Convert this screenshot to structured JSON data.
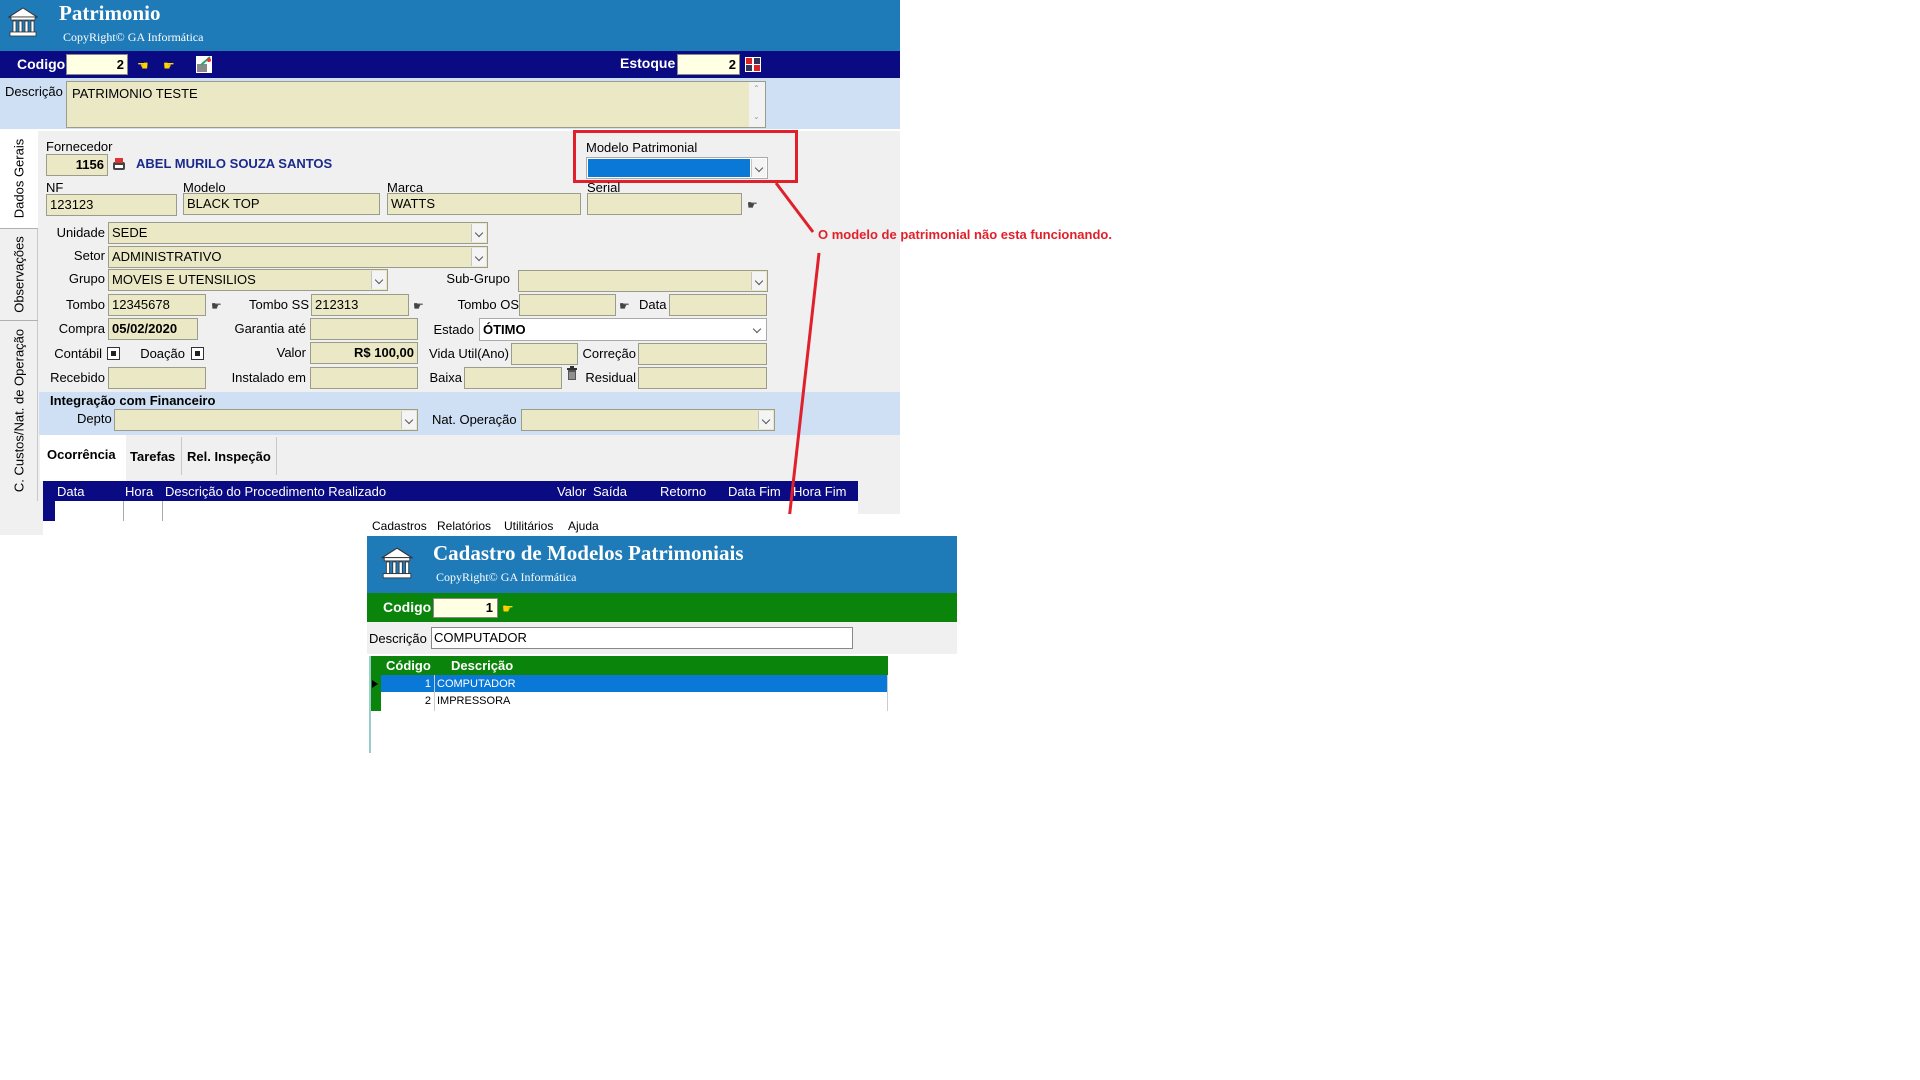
{
  "patrimonio": {
    "title": "Patrimonio",
    "copyright": "CopyRight© GA Informática",
    "codigo_label": "Codigo",
    "codigo_value": "2",
    "estoque_label": "Estoque",
    "estoque_value": "2",
    "descricao_label": "Descrição",
    "descricao_value": "PATRIMONIO TESTE",
    "side_tabs": [
      "Dados Gerais",
      "Observações",
      "C. Custos/Nat. de Operação"
    ],
    "fornecedor_label": "Fornecedor",
    "fornecedor_code": "1156",
    "fornecedor_name": "ABEL MURILO SOUZA SANTOS",
    "modelo_patrimonial_label": "Modelo Patrimonial",
    "modelo_patrimonial_value": "",
    "nf_label": "NF",
    "nf_value": "123123",
    "modelo_label": "Modelo",
    "modelo_value": "BLACK TOP",
    "marca_label": "Marca",
    "marca_value": "WATTS",
    "serial_label": "Serial",
    "serial_value": "",
    "unidade_label": "Unidade",
    "unidade_value": "SEDE",
    "setor_label": "Setor",
    "setor_value": "ADMINISTRATIVO",
    "grupo_label": "Grupo",
    "grupo_value": "MOVEIS E UTENSILIOS",
    "subgrupo_label": "Sub-Grupo",
    "subgrupo_value": "",
    "tombo_label": "Tombo",
    "tombo_value": "12345678",
    "tombo_ss_label": "Tombo SS",
    "tombo_ss_value": "212313",
    "tombo_os_label": "Tombo OS",
    "tombo_os_value": "",
    "data_label": "Data",
    "data_value": "",
    "compra_label": "Compra",
    "compra_value": "05/02/2020",
    "garantia_label": "Garantia até",
    "garantia_value": "",
    "estado_label": "Estado",
    "estado_value": "ÓTIMO",
    "contabil_label": "Contábil",
    "doacao_label": "Doação",
    "valor_label": "Valor",
    "valor_value": "R$ 100,00",
    "vida_util_label": "Vida Util(Ano)",
    "vida_util_value": "",
    "correcao_label": "Correção",
    "correcao_value": "",
    "recebido_label": "Recebido",
    "recebido_value": "",
    "instalado_label": "Instalado em",
    "instalado_value": "",
    "baixa_label": "Baixa",
    "baixa_value": "",
    "residual_label": "Residual",
    "residual_value": "",
    "integracao_label": "Integração com Financeiro",
    "depto_label": "Depto",
    "depto_value": "",
    "nat_operacao_label": "Nat. Operação",
    "nat_operacao_value": "",
    "bottom_tabs": [
      "Ocorrência",
      "Tarefas",
      "Rel. Inspeção"
    ],
    "grid_headers": [
      "Data",
      "Hora",
      "Descrição do Procedimento Realizado",
      "Valor",
      "Saída",
      "Retorno",
      "Data Fim",
      "Hora Fim"
    ]
  },
  "annotation": {
    "text": "O modelo de patrimonial não esta funcionando.",
    "color": "#e0202a"
  },
  "modelos": {
    "menu": [
      "Cadastros",
      "Relatórios",
      "Utilitários",
      "Ajuda"
    ],
    "title": "Cadastro de Modelos Patrimoniais",
    "copyright": "CopyRight© GA Informática",
    "codigo_label": "Codigo",
    "codigo_value": "1",
    "descricao_label": "Descrição",
    "descricao_value": "COMPUTADOR",
    "grid_headers": [
      "Código",
      "Descrição"
    ],
    "rows": [
      {
        "codigo": "1",
        "descricao": "COMPUTADOR"
      },
      {
        "codigo": "2",
        "descricao": "IMPRESSORA"
      }
    ]
  },
  "colors": {
    "header_blue": "#1f7ab8",
    "nav_blue": "#0a0a82",
    "field_bg": "#ebe8c6",
    "section_blue": "#cfe0f4",
    "header_green": "#0b840b",
    "selection_blue": "#0a78d7"
  }
}
